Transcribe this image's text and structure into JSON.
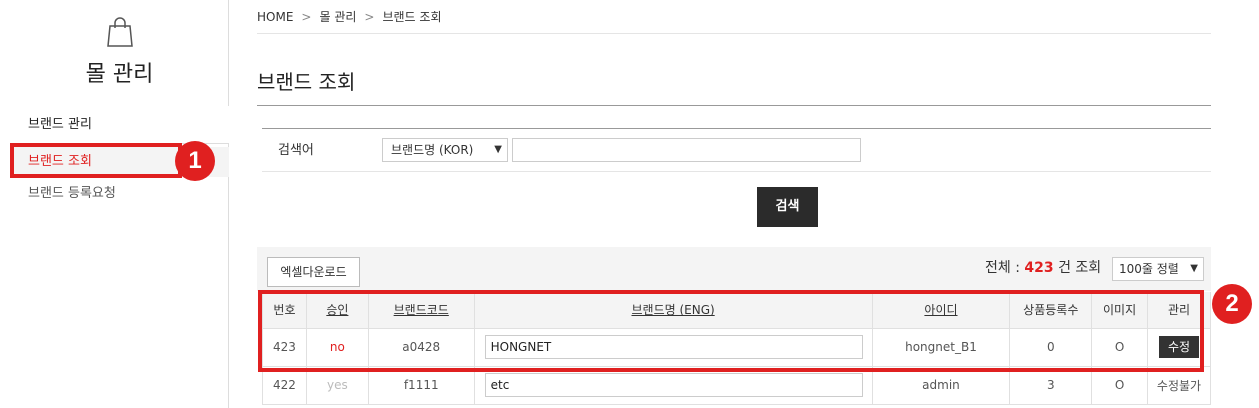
{
  "sidebar": {
    "title": "몰 관리",
    "group_label": "브랜드 관리",
    "items": [
      {
        "label": "브랜드 조회"
      },
      {
        "label": "브랜드 등록요청"
      }
    ]
  },
  "badges": {
    "one": "1",
    "two": "2"
  },
  "breadcrumb": {
    "home": "HOME",
    "level1": "몰 관리",
    "level2": "브랜드 조회",
    "sep": ">"
  },
  "page": {
    "title": "브랜드 조회"
  },
  "search": {
    "label": "검색어",
    "select_value": "브랜드명 (KOR)",
    "input_value": "",
    "button_label": "검색"
  },
  "list": {
    "excel_button": "엑셀다운로드",
    "total_prefix": "전체 : ",
    "total_count": "423",
    "total_suffix": " 건 조회",
    "sort_value": "100줄 정렬"
  },
  "table": {
    "headers": [
      "번호",
      "승인",
      "브랜드코드",
      "브랜드명 (ENG)",
      "아이디",
      "상품등록수",
      "이미지",
      "관리"
    ],
    "rows": [
      {
        "no": "423",
        "approval": "no",
        "code": "a0428",
        "name": "HONGNET",
        "id": "hongnet_B1",
        "count": "0",
        "image": "O",
        "manage": "수정"
      },
      {
        "no": "422",
        "approval": "yes",
        "code": "f1111",
        "name": "etc",
        "id": "admin",
        "count": "3",
        "image": "O",
        "manage": "수정불가"
      }
    ]
  },
  "colors": {
    "accent": "#e02020",
    "dark_button": "#2b2b2b"
  },
  "icons": {
    "sidebar": "shopping-bag-icon"
  }
}
